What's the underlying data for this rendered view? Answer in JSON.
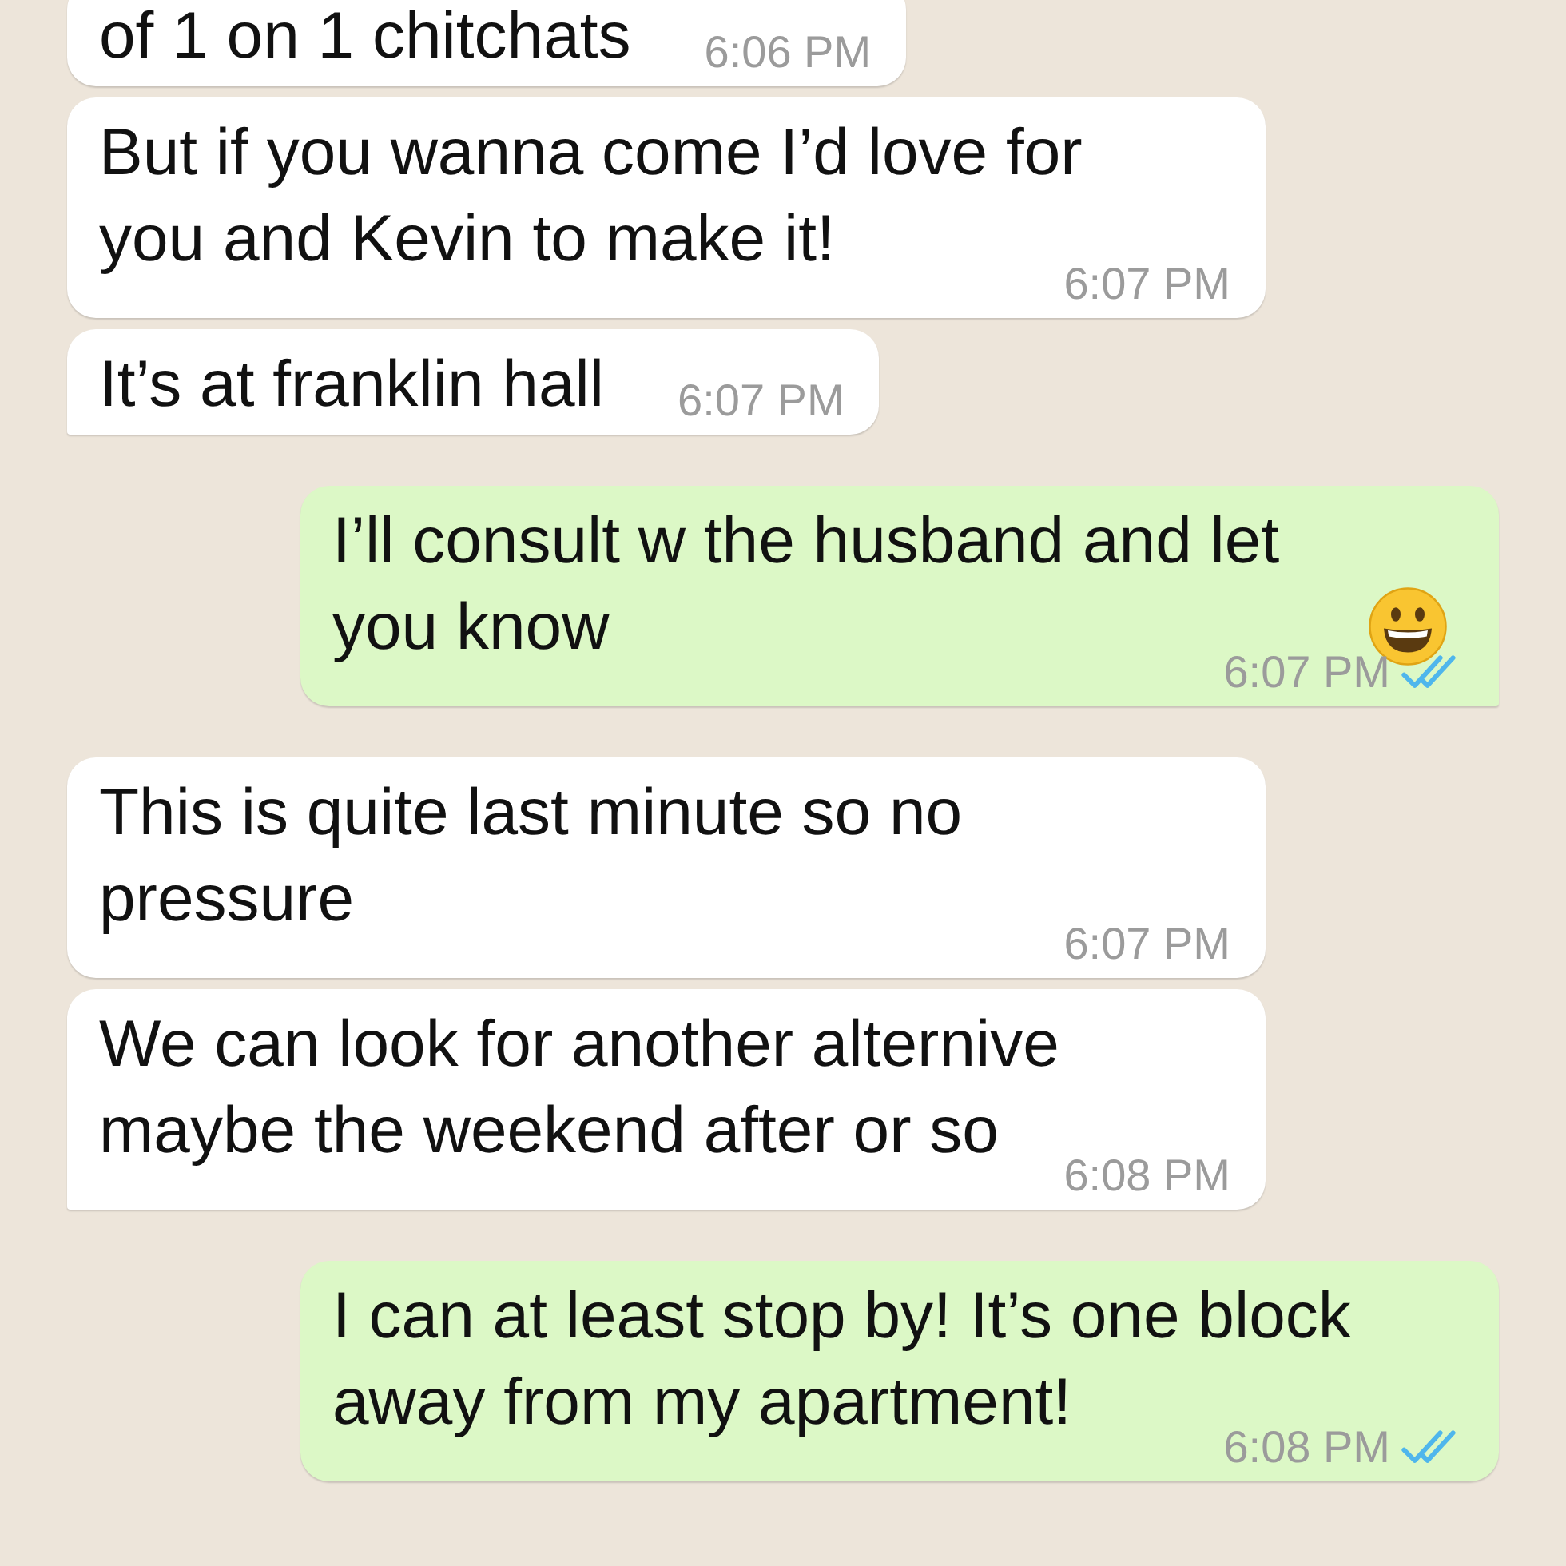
{
  "messages": [
    {
      "kind": "incoming",
      "text": "of 1 on 1 chitchats",
      "time": "6:06 PM",
      "tail": false
    },
    {
      "kind": "incoming",
      "text": "But if you wanna come I’d love for you and Kevin to make it!",
      "time": "6:07 PM",
      "tail": false
    },
    {
      "kind": "incoming",
      "text": "It’s at franklin hall",
      "time": "6:07 PM",
      "tail": true
    },
    {
      "kind": "outgoing",
      "text": "I’ll consult w the husband and let you know",
      "smiley": true,
      "time": "6:07 PM",
      "read": true,
      "tail": true
    },
    {
      "kind": "incoming",
      "text": "This is quite last minute so no pressure",
      "time": "6:07 PM",
      "tail": false
    },
    {
      "kind": "incoming",
      "text": "We can look for another alternive maybe the weekend after or so",
      "time": "6:08 PM",
      "tail": true
    },
    {
      "kind": "outgoing",
      "text": "I can at least stop by! It’s one block away from my apartment!",
      "time": "6:08 PM",
      "read": true,
      "tail": false
    }
  ]
}
